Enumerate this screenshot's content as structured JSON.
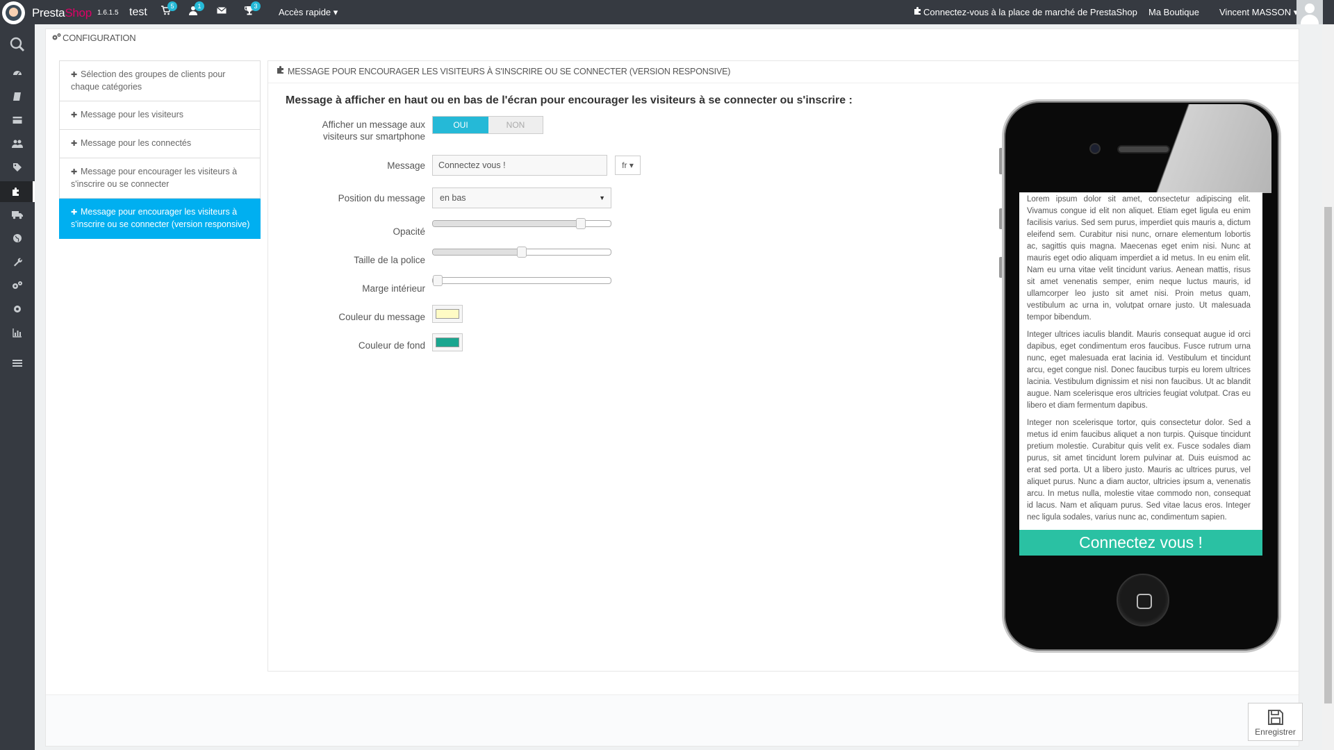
{
  "header": {
    "brand_part1": "Presta",
    "brand_part2": "Shop",
    "version": "1.6.1.5",
    "shop_name": "test",
    "cart_badge": "5",
    "customers_badge": "1",
    "trophy_badge": "3",
    "quick_access": "Accès rapide ▾",
    "marketplace_link": "Connectez-vous à la place de marché de PrestaShop",
    "my_shop": "Ma Boutique",
    "user_name": "Vincent MASSON ▾"
  },
  "sidebar": {
    "icons": [
      "search-icon",
      "dashboard-icon",
      "orders-icon",
      "catalog-icon",
      "customers-icon",
      "price-rules-icon",
      "modules-icon",
      "shipping-icon",
      "localization-icon",
      "preferences-icon",
      "advanced-parameters-icon",
      "administration-icon",
      "stats-icon",
      "menu-icon"
    ]
  },
  "page": {
    "config_title": "CONFIGURATION"
  },
  "tabs": [
    {
      "label": "Sélection des groupes de clients pour chaque catégories",
      "active": false
    },
    {
      "label": "Message pour les visiteurs",
      "active": false
    },
    {
      "label": "Message pour les connectés",
      "active": false
    },
    {
      "label": "Message pour encourager les visiteurs à s'inscrire ou se connecter",
      "active": false
    },
    {
      "label": "Message pour encourager les visiteurs à s'inscrire ou se connecter (version responsive)",
      "active": true
    }
  ],
  "panel": {
    "heading": "MESSAGE POUR ENCOURAGER LES VISITEURS À S'INSCRIRE OU SE CONNECTER (VERSION RESPONSIVE)",
    "form_title": "Message à afficher en haut ou en bas de l'écran pour encourager les visiteurs à se connecter ou s'inscrire :"
  },
  "form": {
    "show_label": "Afficher un message aux visiteurs sur smartphone",
    "switch_on": "OUI",
    "switch_off": "NON",
    "switch_value": "on",
    "message_label": "Message",
    "message_value": "Connectez vous !",
    "lang": "fr ▾",
    "position_label": "Position du message",
    "position_value": "en bas",
    "opacity_label": "Opacité",
    "opacity_value": 0.85,
    "font_size_label": "Taille de la police",
    "font_size_value": 0.5,
    "padding_label": "Marge intérieur",
    "padding_value": 0,
    "text_color_label": "Couleur du message",
    "text_color": "#fffbc5",
    "bg_color_label": "Couleur de fond",
    "bg_color": "#1aa68f"
  },
  "phone_preview": {
    "paragraphs": [
      "Lorem ipsum dolor sit amet, consectetur adipiscing elit. Vivamus congue id elit non aliquet. Etiam eget ligula eu enim facilisis varius. Sed sem purus, imperdiet quis mauris a, dictum eleifend sem. Curabitur nisi nunc, ornare elementum lobortis ac, sagittis quis magna. Maecenas eget enim nisi. Nunc at mauris eget odio aliquam imperdiet a id metus. In eu enim elit. Nam eu urna vitae velit tincidunt varius. Aenean mattis, risus sit amet venenatis semper, enim neque luctus mauris, id ullamcorper leo justo sit amet nisi. Proin metus quam, vestibulum ac urna in, volutpat ornare justo. Ut malesuada tempor bibendum.",
      "Integer ultrices iaculis blandit. Mauris consequat augue id orci dapibus, eget condimentum eros faucibus. Fusce rutrum urna nunc, eget malesuada erat lacinia id. Vestibulum et tincidunt arcu, eget congue nisl. Donec faucibus turpis eu lorem ultrices lacinia. Vestibulum dignissim et nisi non faucibus. Ut ac blandit augue. Nam scelerisque eros ultricies feugiat volutpat. Cras eu libero et diam fermentum dapibus.",
      "Integer non scelerisque tortor, quis consectetur dolor. Sed a metus id enim faucibus aliquet a non turpis. Quisque tincidunt pretium molestie. Curabitur quis velit ex. Fusce sodales diam purus, sit amet tincidunt lorem pulvinar at. Duis euismod ac erat sed porta. Ut a libero justo. Mauris ac ultrices purus, vel aliquet purus. Nunc a diam auctor, ultricies ipsum a, venenatis arcu. In metus nulla, molestie vitae commodo non, consequat id lacus. Nam et aliquam purus. Sed vitae lacus eros. Integer nec ligula sodales, varius nunc ac, condimentum sapien."
    ],
    "bar_text": "Connectez vous !"
  },
  "footer": {
    "save_label": "Enregistrer"
  }
}
